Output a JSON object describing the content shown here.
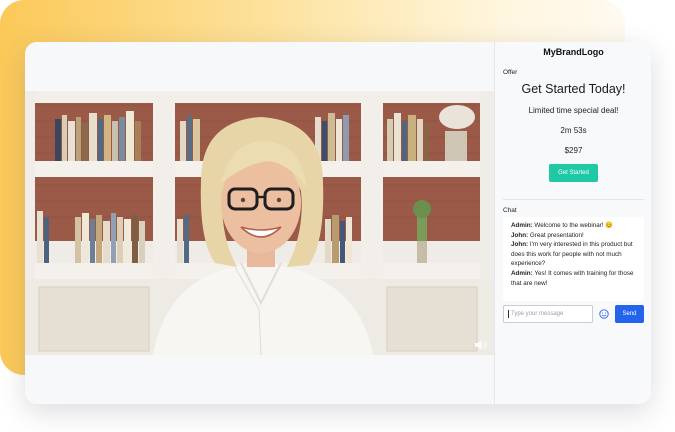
{
  "brand": {
    "logo_text": "MyBrandLogo"
  },
  "video": {
    "description_icon": "speaker-icon"
  },
  "offer": {
    "section_label": "Offer",
    "title": "Get Started Today!",
    "subtitle": "Limited time special deal!",
    "timer": "2m 53s",
    "price": "$297",
    "cta_label": "Get Started",
    "cta_color": "#1ec9a3"
  },
  "chat": {
    "section_label": "Chat",
    "messages": [
      {
        "author": "Admin:",
        "text": " Welcome to the webinar! 😊"
      },
      {
        "author": "John:",
        "text": " Great presentation!"
      },
      {
        "author": "John:",
        "text": " I'm very interested in this product but does this work for people with not much experience?"
      },
      {
        "author": "Admin:",
        "text": " Yes! It comes with training for those that are new!"
      }
    ],
    "input_placeholder": "Type your message",
    "send_label": "Send",
    "send_color": "#2463eb",
    "emoji_icon": "smiley-icon"
  },
  "colors": {
    "blob_start": "#fbc958",
    "blob_end": "#fffaf0"
  }
}
